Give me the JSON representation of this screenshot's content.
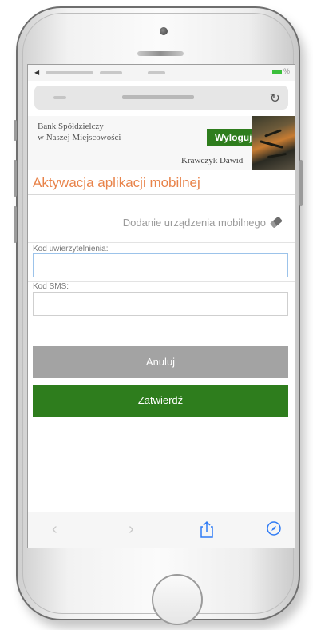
{
  "bank": {
    "name_line1": "Bank Spółdzielczy",
    "name_line2": "w Naszej Miejscowości",
    "logout_label": "Wyloguj",
    "user_name": "Krawczyk Dawid"
  },
  "page": {
    "title": "Aktywacja aplikacji mobilnej",
    "subtitle": "Dodanie urządzenia mobilnego"
  },
  "form": {
    "auth_code_label": "Kod uwierzytelnienia:",
    "auth_code_value": "",
    "sms_code_label": "Kod SMS:",
    "sms_code_value": ""
  },
  "buttons": {
    "cancel": "Anuluj",
    "confirm": "Zatwierdź"
  },
  "browser": {
    "reload_icon": "reload-icon",
    "toolbar_icons": [
      "back-icon",
      "forward-icon",
      "share-icon",
      "compass-icon"
    ]
  },
  "colors": {
    "brand_green": "#2e7d1d",
    "title_orange": "#e8834a",
    "button_gray": "#a3a3a3",
    "ios_blue": "#2f7bf5"
  }
}
